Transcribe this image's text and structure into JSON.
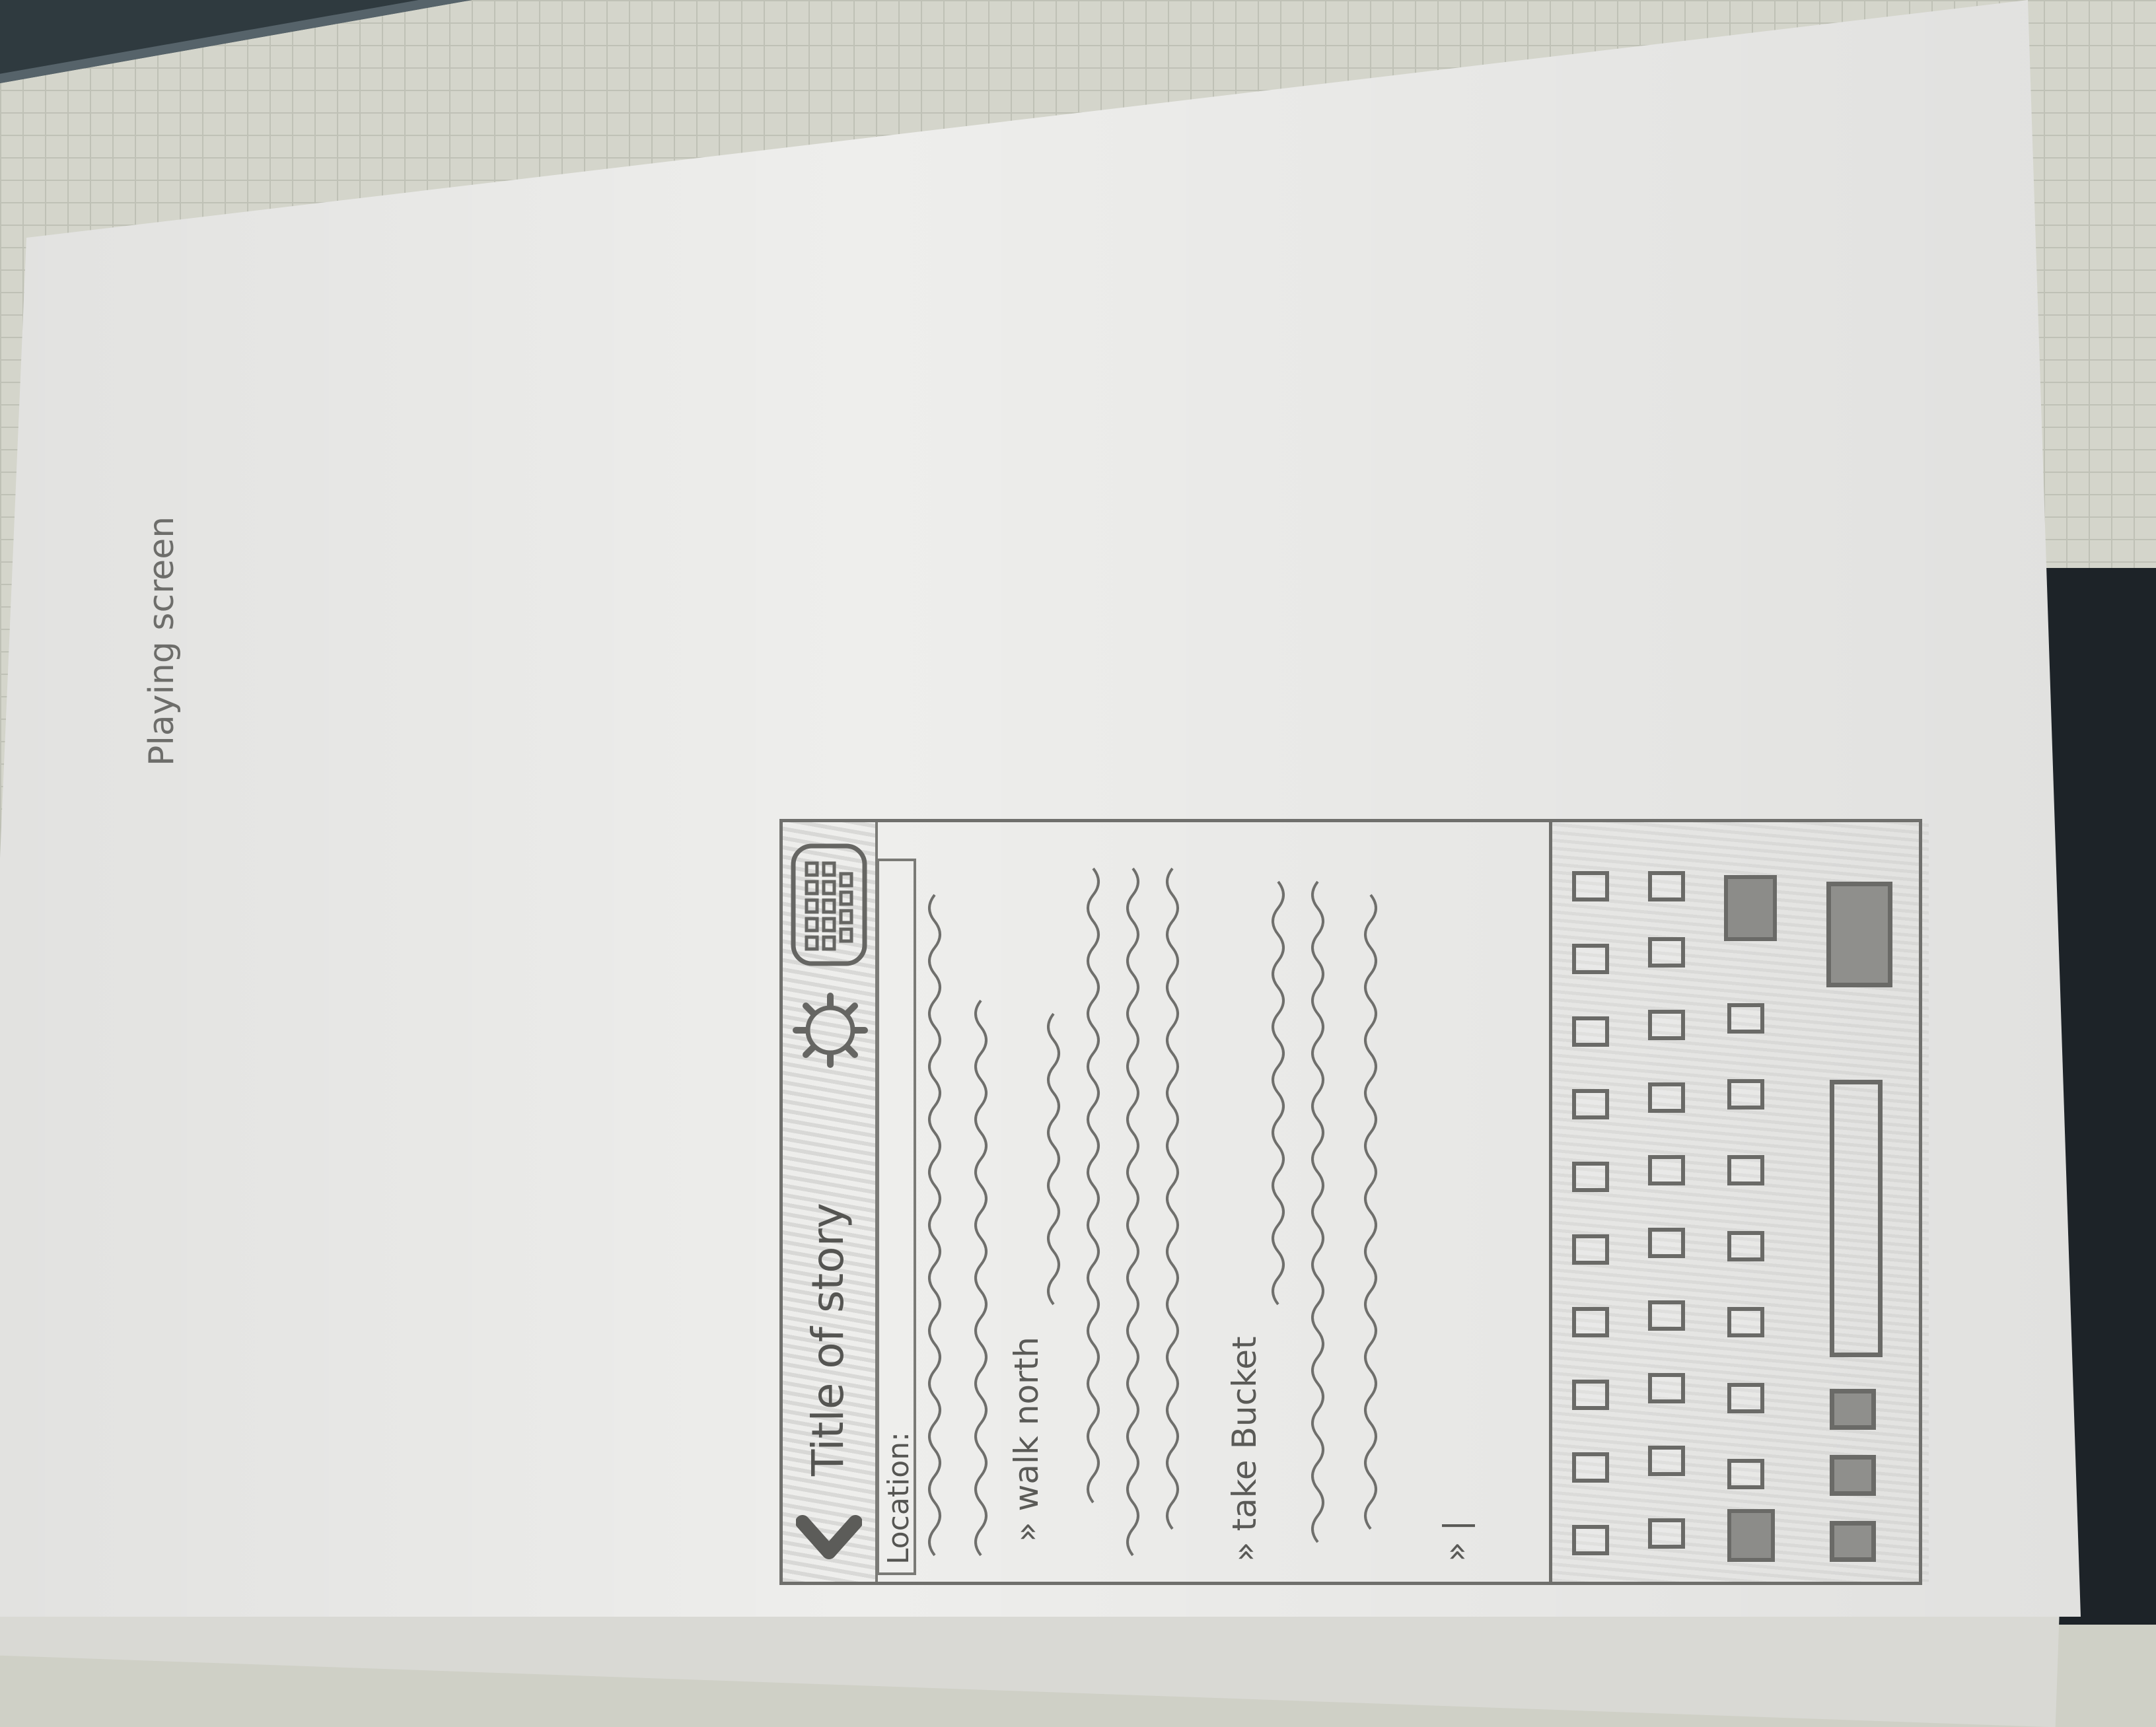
{
  "sketch": {
    "heading": "Playing screen",
    "header": {
      "title": "Title of story",
      "icons": [
        "back-arrow-icon",
        "gear-icon",
        "keyboard-icon"
      ]
    },
    "location_label": "Location:",
    "commands": [
      {
        "prefix": "»",
        "text": "walk north"
      },
      {
        "prefix": "»",
        "text": "take Bucket"
      },
      {
        "prefix": "»",
        "text": "|"
      }
    ],
    "keyboard": {
      "rows": [
        10,
        10,
        9
      ],
      "bottom_keys": [
        "special-key",
        "special-key",
        "special-key",
        "spacebar",
        "enter-key"
      ]
    }
  }
}
